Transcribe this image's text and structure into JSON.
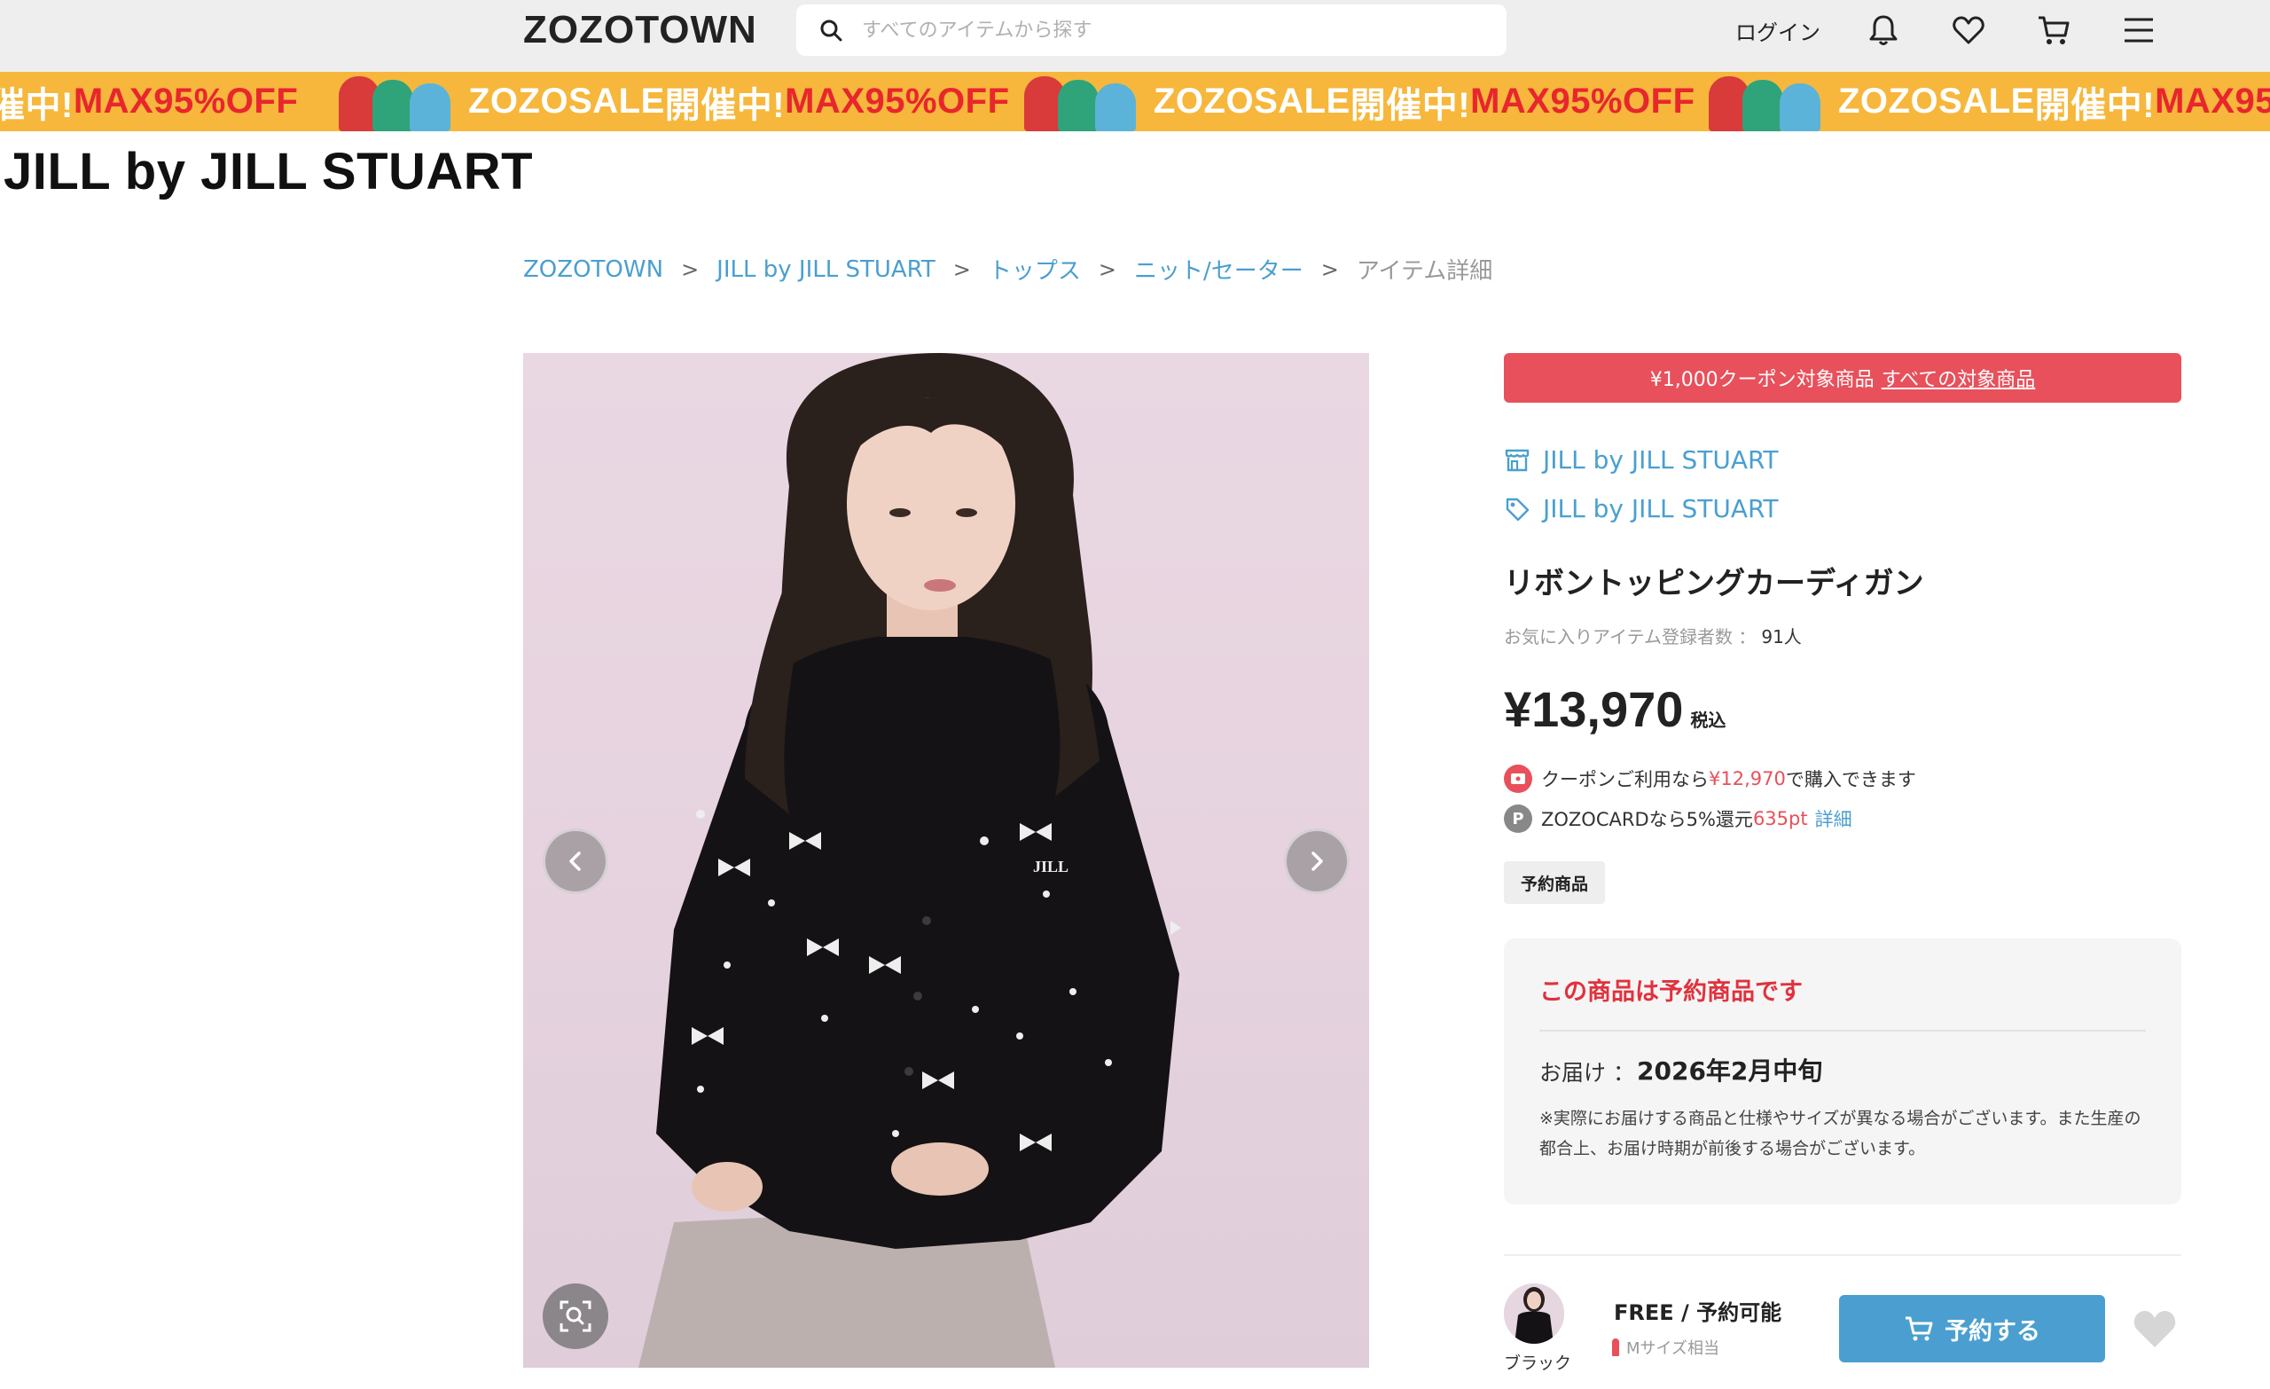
{
  "header": {
    "logo": "ZOZOTOWN",
    "search_placeholder": "すべてのアイテムから探す",
    "login_label": "ログイン",
    "icons": [
      "bell-icon",
      "heart-icon",
      "cart-icon",
      "menu-icon"
    ]
  },
  "banner": {
    "sale_name": "ZOZOSALE",
    "sale_status": "開催中!",
    "sale_offer": "MAX95%OFF",
    "leading_fragment_status": "催中!",
    "trailing_fragment_offer": "MAX95"
  },
  "brand_heading": "JILL by JILL STUART",
  "breadcrumb": {
    "items": [
      "ZOZOTOWN",
      "JILL by JILL STUART",
      "トップス",
      "ニット/セーター"
    ],
    "current": "アイテム詳細"
  },
  "product": {
    "coupon_text": "¥1,000クーポン対象商品",
    "coupon_link": "すべての対象商品",
    "shop_name": "JILL by JILL STUART",
    "brand_name": "JILL by JILL STUART",
    "name": "リボントッピングカーディガン",
    "favorite_label": "お気に入りアイテム登録者数 ：",
    "favorite_count": "91人",
    "price": "¥13,970",
    "tax_label": "税込",
    "coupon_note_prefix": "クーポンご利用なら",
    "coupon_price": "¥12,970",
    "coupon_note_suffix": "で購入できます",
    "card_note": "ZOZOCARDなら5%還元",
    "card_points": "635pt",
    "card_detail_link": "詳細",
    "tag": "予約商品",
    "badge_p": "P"
  },
  "preorder": {
    "title": "この商品は予約商品です",
    "delivery_label": "お届け ：",
    "delivery_value": "2026年2月中旬",
    "caution": "※実際にお届けする商品と仕様やサイズが異なる場合がございます。また生産の都合上、お届け時期が前後する場合がございます。"
  },
  "sku": {
    "color": "ブラック",
    "size_status": "FREE / 予約可能",
    "fit": "Mサイズ相当",
    "reserve_label": "予約する"
  },
  "colors": {
    "accent_blue": "#4a9fd0",
    "coupon_red": "#e8505b",
    "banner_yellow": "#f6b73c",
    "header_gray": "#eeeeee"
  }
}
